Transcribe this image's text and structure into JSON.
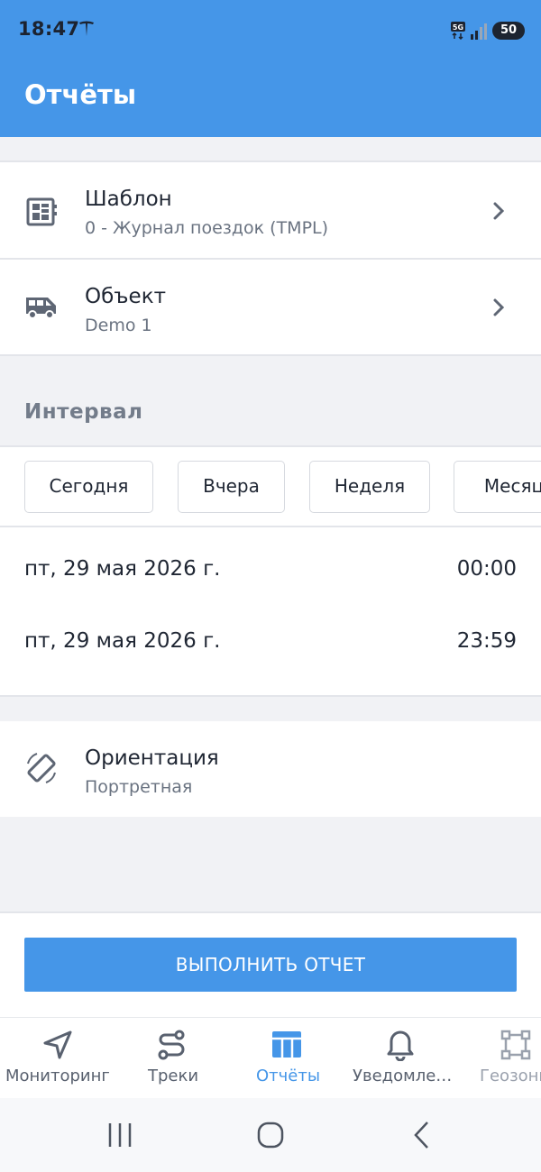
{
  "status_bar": {
    "time": "18:47",
    "network": "5G",
    "battery": "50"
  },
  "header": {
    "title": "Отчёты"
  },
  "template_row": {
    "title": "Шаблон",
    "subtitle": "0 - Журнал поездок (TMPL)"
  },
  "object_row": {
    "title": "Объект",
    "subtitle": "Demo 1"
  },
  "interval": {
    "label": "Интервал",
    "chips": [
      "Сегодня",
      "Вчера",
      "Неделя",
      "Месяц"
    ],
    "from": {
      "date": "пт, 29 мая 2026 г.",
      "time": "00:00"
    },
    "to": {
      "date": "пт, 29 мая 2026 г.",
      "time": "23:59"
    }
  },
  "orientation_row": {
    "title": "Ориентация",
    "subtitle": "Портретная"
  },
  "run_button": {
    "label": "ВЫПОЛНИТЬ ОТЧЕТ"
  },
  "bottom_nav": {
    "items": [
      {
        "label": "Мониторинг",
        "icon": "navigation-arrow-icon",
        "active": false
      },
      {
        "label": "Треки",
        "icon": "route-icon",
        "active": false
      },
      {
        "label": "Отчёты",
        "icon": "table-icon",
        "active": true
      },
      {
        "label": "Уведомле…",
        "icon": "bell-icon",
        "active": false
      },
      {
        "label": "Геозоны",
        "icon": "geofence-icon",
        "active": false
      }
    ],
    "active_color": "#4596e8",
    "inactive_color": "#59616f"
  },
  "colors": {
    "accent": "#4596e8",
    "background": "#f1f2f5",
    "text": "#1f2633",
    "subtext": "#6a7381"
  }
}
